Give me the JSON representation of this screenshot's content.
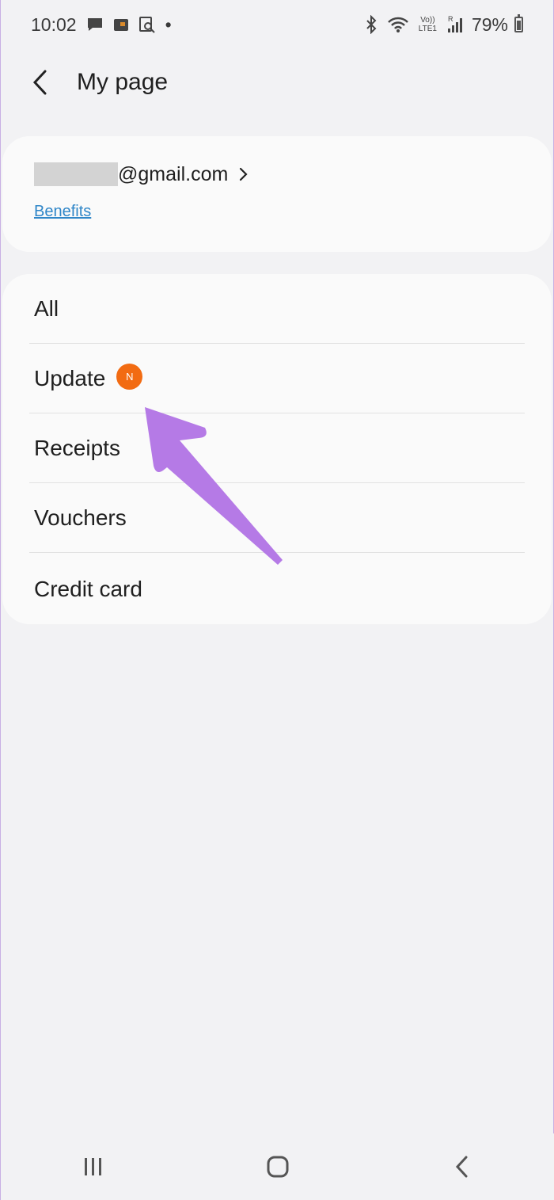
{
  "status_bar": {
    "time": "10:02",
    "notification_icons": [
      "message-icon",
      "app-icon",
      "screenshot-icon"
    ],
    "dot": "•",
    "battery": "79%",
    "network_label": "LTE1"
  },
  "app_bar": {
    "title": "My page"
  },
  "account": {
    "email_suffix": "@gmail.com",
    "benefits_link": "Benefits"
  },
  "menu": {
    "items": [
      {
        "label": "All"
      },
      {
        "label": "Update",
        "badge": "N"
      },
      {
        "label": "Receipts"
      },
      {
        "label": "Vouchers"
      },
      {
        "label": "Credit card"
      }
    ]
  },
  "colors": {
    "background": "#f2f2f4",
    "card": "#fafafa",
    "link": "#2f86c8",
    "badge": "#f26b12",
    "annotation_arrow": "#b57ae6"
  }
}
